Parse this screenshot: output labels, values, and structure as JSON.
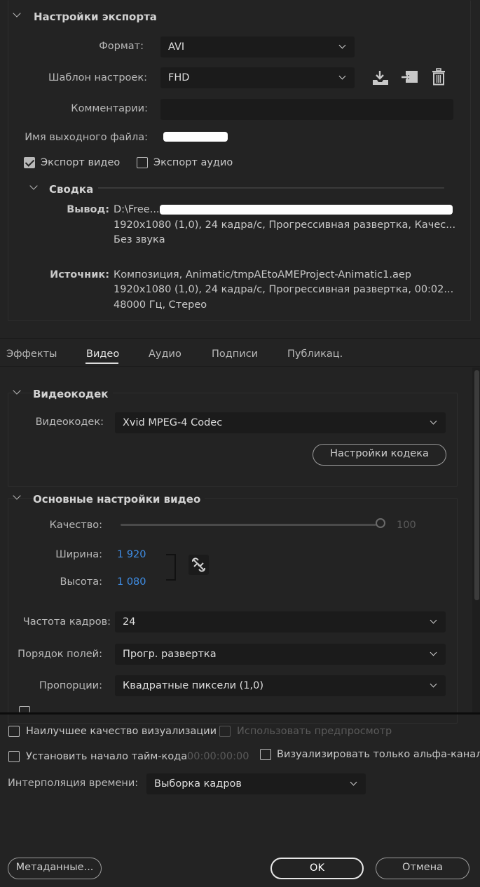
{
  "export_settings": {
    "title": "Настройки экспорта",
    "format_label": "Формат:",
    "format_value": "AVI",
    "preset_label": "Шаблон настроек:",
    "preset_value": "FHD",
    "comments_label": "Комментарии:",
    "comments_value": "",
    "output_name_label": "Имя выходного файла:",
    "export_video_label": "Экспорт видео",
    "export_video_checked": true,
    "export_audio_label": "Экспорт аудио",
    "export_audio_checked": false,
    "summary": {
      "title": "Сводка",
      "output_label": "Вывод:",
      "output_line1": "D:\\Free...",
      "output_line2": "1920x1080 (1,0), 24 кадра/с, Прогрессивная развертка, Качес...",
      "output_line3": "Без звука",
      "source_label": "Источник:",
      "source_line1": "Композиция, Animatic/tmpAEtoAMEProject-Animatic1.aep",
      "source_line2": "1920x1080 (1,0), 24 кадра/с, Прогрессивная развертка, 00:02...",
      "source_line3": "48000 Гц, Стерео"
    }
  },
  "tabs": [
    "Эффекты",
    "Видео",
    "Аудио",
    "Подписи",
    "Публикац."
  ],
  "active_tab": "Видео",
  "video_codec": {
    "title": "Видеокодек",
    "codec_label": "Видеокодек:",
    "codec_value": "Xvid MPEG-4 Codec",
    "codec_settings_button": "Настройки кодека"
  },
  "basic_video": {
    "title": "Основные настройки видео",
    "quality_label": "Качество:",
    "quality_value": "100",
    "width_label": "Ширина:",
    "width_value": "1 920",
    "height_label": "Высота:",
    "height_value": "1 080",
    "framerate_label": "Частота кадров:",
    "framerate_value": "24",
    "field_order_label": "Порядок полей:",
    "field_order_value": "Прогр. развертка",
    "aspect_label": "Пропорции:",
    "aspect_value": "Квадратные пиксели (1,0)"
  },
  "bottom": {
    "max_render_quality_label": "Наилучшее качество визуализации",
    "use_previews_label": "Использовать предпросмотр",
    "set_start_timecode_label": "Установить начало тайм-кода",
    "timecode_value": "00:00:00:00",
    "render_alpha_label": "Визуализировать только альфа-канал",
    "time_interp_label": "Интерполяция времени:",
    "time_interp_value": "Выборка кадров",
    "metadata_button": "Метаданные...",
    "ok_button": "OK",
    "cancel_button": "Отмена"
  },
  "colors": {
    "background": "#232323",
    "field": "#1b1b1b",
    "accent_blue": "#3f8ee6"
  },
  "icons": [
    "chevron-down-icon",
    "save-preset-icon",
    "import-preset-icon",
    "trash-icon",
    "link-icon"
  ]
}
